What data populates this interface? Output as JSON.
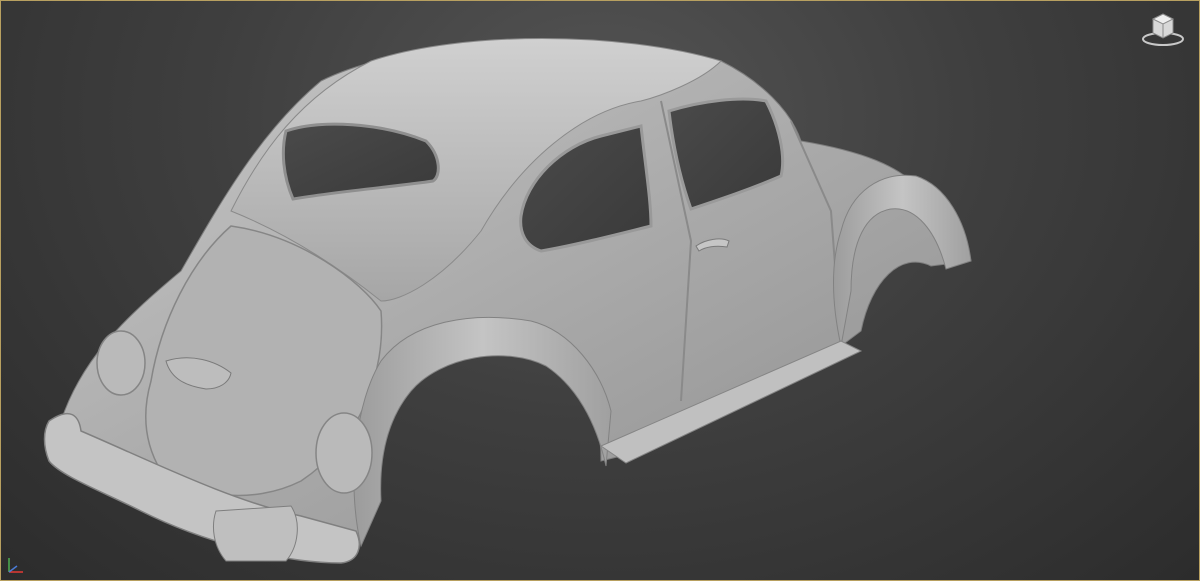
{
  "viewport": {
    "background_top": "#545454",
    "background_bottom": "#2c2c2c",
    "border_color": "#b8a060",
    "model_color": "#b4b4b4"
  },
  "overlays": {
    "viewcube_icon": "viewcube-icon",
    "axis_icon": "axis-tripod-icon"
  }
}
